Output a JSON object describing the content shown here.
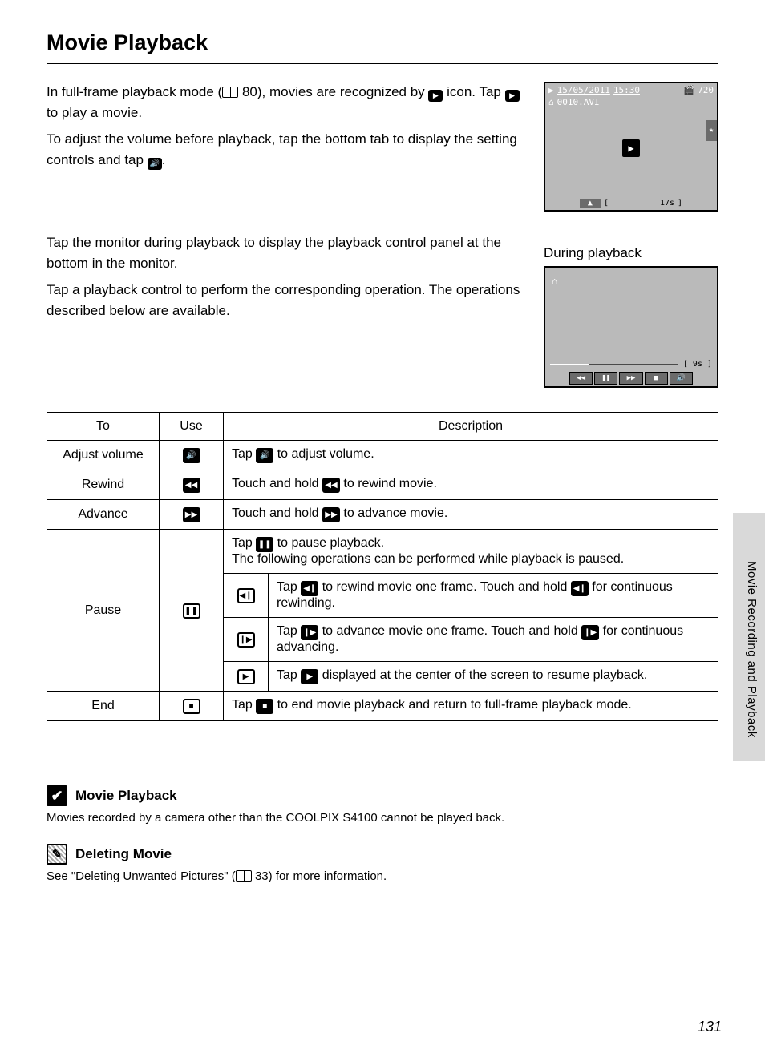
{
  "title": "Movie Playback",
  "intro": {
    "p1a": "In full-frame playback mode (",
    "p1b": "80), movies are recognized by ",
    "p1c": " icon. Tap ",
    "p1d": " to play a movie.",
    "p2a": "To adjust the volume before playback, tap the bottom tab to display the setting controls and tap ",
    "p2b": "."
  },
  "screen1": {
    "date": "15/05/2011",
    "time": "15:30",
    "res": "720",
    "file": "0010.AVI",
    "duration": "17s"
  },
  "during_label": "During playback",
  "screen2": {
    "remaining": "9s"
  },
  "mid": {
    "p1": "Tap the monitor during playback to display the playback control panel at the bottom in the monitor.",
    "p2": "Tap a playback control to perform the corresponding operation. The operations described below are available."
  },
  "table": {
    "h1": "To",
    "h2": "Use",
    "h3": "Description",
    "r1": {
      "to": "Adjust volume",
      "desc_a": "Tap ",
      "desc_b": " to adjust volume."
    },
    "r2": {
      "to": "Rewind",
      "desc_a": "Touch and hold ",
      "desc_b": " to rewind movie."
    },
    "r3": {
      "to": "Advance",
      "desc_a": "Touch and hold ",
      "desc_b": " to advance movie."
    },
    "r4": {
      "to": "Pause",
      "top_a": "Tap ",
      "top_b": " to pause playback.",
      "top_c": "The following operations can be performed while playback is paused.",
      "s1a": "Tap ",
      "s1b": " to rewind movie one frame. Touch and hold ",
      "s1c": " for continuous rewinding.",
      "s2a": "Tap ",
      "s2b": " to advance movie one frame. Touch and hold ",
      "s2c": " for continuous advancing.",
      "s3a": "Tap ",
      "s3b": " displayed at the center of the screen to resume playback."
    },
    "r5": {
      "to": "End",
      "desc_a": "Tap ",
      "desc_b": " to end movie playback and return to full-frame playback mode."
    }
  },
  "side_text": "Movie Recording and Playback",
  "notes": {
    "n1_title": "Movie Playback",
    "n1_body": "Movies recorded by a camera other than the COOLPIX S4100 cannot be played back.",
    "n2_title": "Deleting Movie",
    "n2_body_a": "See \"Deleting Unwanted Pictures\" (",
    "n2_body_b": "33) for more information."
  },
  "page_num": "131"
}
